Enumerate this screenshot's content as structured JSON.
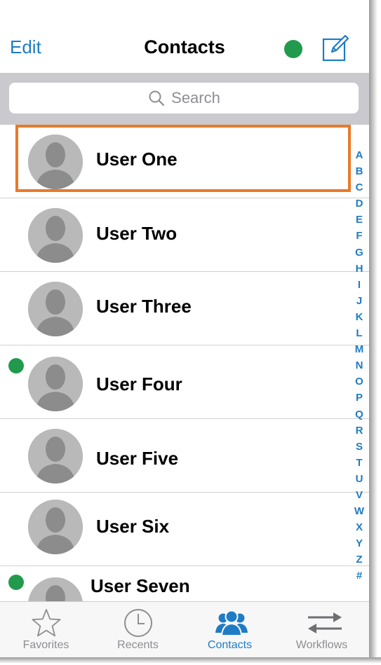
{
  "header": {
    "edit_label": "Edit",
    "title": "Contacts",
    "presence_color": "#229a4d",
    "compose_icon": "compose-icon"
  },
  "search": {
    "placeholder": "Search"
  },
  "contacts": [
    {
      "name": "User One",
      "online": false,
      "selected": true
    },
    {
      "name": "User Two",
      "online": false,
      "selected": false
    },
    {
      "name": "User Three",
      "online": false,
      "selected": false
    },
    {
      "name": "User Four",
      "online": true,
      "selected": false
    },
    {
      "name": "User Five",
      "online": false,
      "selected": false
    },
    {
      "name": "User Six",
      "online": false,
      "selected": false
    },
    {
      "name": "User Seven",
      "online": true,
      "selected": false
    }
  ],
  "alphabet_index": [
    "A",
    "B",
    "C",
    "D",
    "E",
    "F",
    "G",
    "H",
    "I",
    "J",
    "K",
    "L",
    "M",
    "N",
    "O",
    "P",
    "Q",
    "R",
    "S",
    "T",
    "U",
    "V",
    "W",
    "X",
    "Y",
    "Z",
    "#"
  ],
  "tabs": [
    {
      "label": "Favorites",
      "icon": "star-icon",
      "active": false
    },
    {
      "label": "Recents",
      "icon": "clock-icon",
      "active": false
    },
    {
      "label": "Contacts",
      "icon": "contacts-icon",
      "active": true
    },
    {
      "label": "Workflows",
      "icon": "arrows-icon",
      "active": false
    }
  ],
  "colors": {
    "accent": "#1f7cc4",
    "highlight": "#e87a2a",
    "online": "#229a4d"
  }
}
